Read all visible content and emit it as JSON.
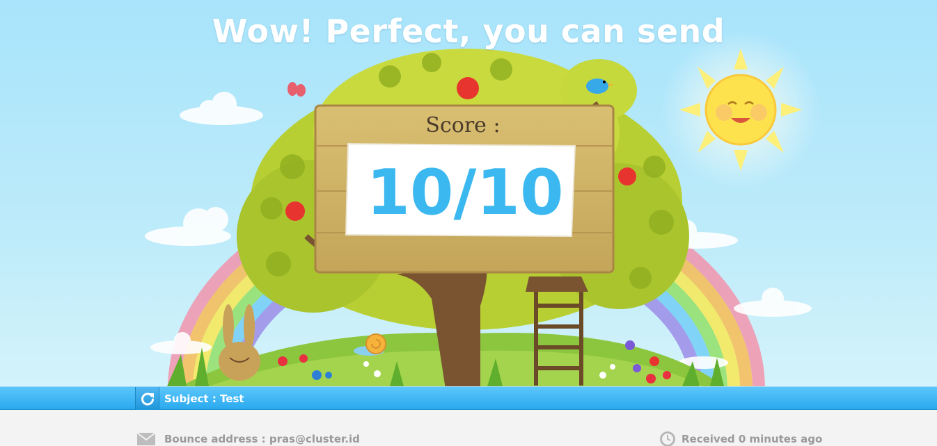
{
  "hero": {
    "headline": "Wow! Perfect, you can send",
    "score_label": "Score :",
    "score_value": "10/10"
  },
  "subject_bar": {
    "refresh_icon": "refresh-icon",
    "subject_text": "Subject : Test"
  },
  "footer": {
    "bounce_icon": "envelope-icon",
    "bounce_text": "Bounce address : pras@cluster.id",
    "received_icon": "clock-icon",
    "received_text": "Received 0 minutes ago"
  },
  "colors": {
    "sky": "#a8e4fb",
    "bar_blue": "#2aa9ef",
    "score_blue": "#3bb8f0",
    "footer_text": "#9a9a9a"
  }
}
